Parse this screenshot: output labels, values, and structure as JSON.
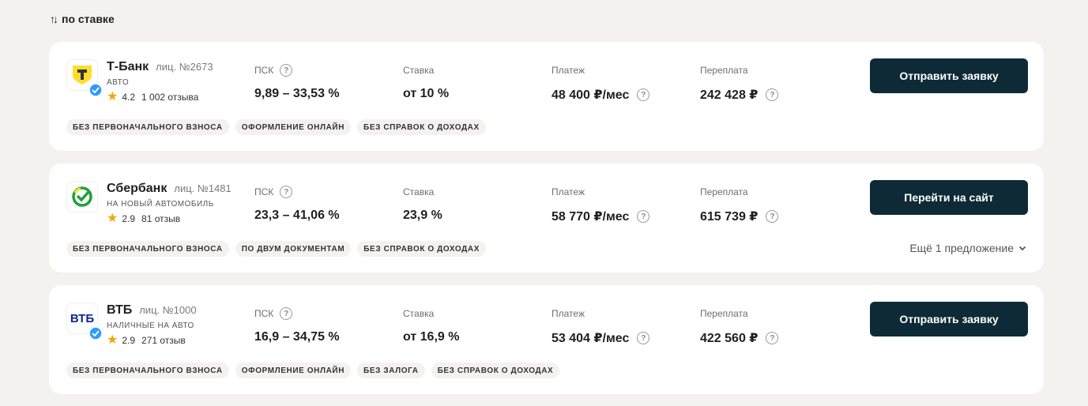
{
  "sort": {
    "arrows": "↑↓",
    "label": "по ставке"
  },
  "offers": [
    {
      "bank": "Т-Банк",
      "license": "лиц. №2673",
      "product": "авто",
      "rating": "4.2",
      "reviews": "1 002 отзыва",
      "psk_label": "ПСК",
      "psk": "9,89 – 33,53 %",
      "rate_label": "Ставка",
      "rate": "от 10 %",
      "payment_label": "Платеж",
      "payment": "48 400 ₽/мес",
      "overpay_label": "Переплата",
      "overpay": "242 428 ₽",
      "button": "Отправить заявку",
      "tags": [
        "Без первоначального взноса",
        "Оформление онлайн",
        "Без справок о доходах"
      ],
      "logo_icon": "tbank-logo-icon",
      "verified": true
    },
    {
      "bank": "Сбербанк",
      "license": "лиц. №1481",
      "product": "на новый автомобиль",
      "rating": "2.9",
      "reviews": "81 отзыв",
      "psk_label": "ПСК",
      "psk": "23,3 – 41,06 %",
      "rate_label": "Ставка",
      "rate": "23,9 %",
      "payment_label": "Платеж",
      "payment": "58 770 ₽/мес",
      "overpay_label": "Переплата",
      "overpay": "615 739 ₽",
      "button": "Перейти на сайт",
      "tags": [
        "Без первоначального взноса",
        "По двум документам",
        "Без справок о доходах"
      ],
      "more": "Ещё 1 предложение",
      "logo_icon": "sber-logo-icon",
      "verified": false
    },
    {
      "bank": "ВТБ",
      "license": "лиц. №1000",
      "product": "наличные на авто",
      "rating": "2.9",
      "reviews": "271 отзыв",
      "psk_label": "ПСК",
      "psk": "16,9 – 34,75 %",
      "rate_label": "Ставка",
      "rate": "от 16,9 %",
      "payment_label": "Платеж",
      "payment": "53 404 ₽/мес",
      "overpay_label": "Переплата",
      "overpay": "422 560 ₽",
      "button": "Отправить заявку",
      "tags": [
        "Без первоначального взноса",
        "Оформление онлайн",
        "Без залога",
        "Без справок о доходах"
      ],
      "logo_icon": "vtb-logo-icon",
      "logo_text": "ВТБ",
      "verified": true
    }
  ],
  "colors": {
    "button_bg": "#0e2a37",
    "star": "#f7a600",
    "tbank_yellow": "#ffdd2d",
    "sber_green": "#21a038",
    "vtb_blue": "#0a2896",
    "verified_blue": "#2f9bff"
  }
}
